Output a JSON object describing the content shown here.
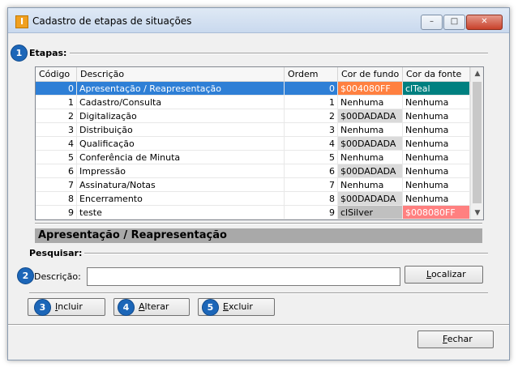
{
  "window": {
    "title": "Cadastro de etapas de situações",
    "app_icon": "I",
    "controls": {
      "minimize": "–",
      "maximize": "□",
      "close": "✕"
    }
  },
  "section_etapas": {
    "badge": "1",
    "label": "Etapas:"
  },
  "grid": {
    "columns": [
      "Código",
      "Descrição",
      "Ordem",
      "Cor de fundo",
      "Cor da fonte"
    ],
    "rows": [
      {
        "codigo": "0",
        "descricao": "Apresentação / Reapresentação",
        "ordem": "0",
        "cor_fundo": "$004080FF",
        "cor_fonte": "clTeal",
        "bg_color": "#ff8040",
        "fg_color": "#008080",
        "selected": true
      },
      {
        "codigo": "1",
        "descricao": "Cadastro/Consulta",
        "ordem": "1",
        "cor_fundo": "Nenhuma",
        "cor_fonte": "Nenhuma"
      },
      {
        "codigo": "2",
        "descricao": "Digitalização",
        "ordem": "2",
        "cor_fundo": "$00DADADA",
        "cor_fonte": "Nenhuma",
        "bg_color": "#dadada"
      },
      {
        "codigo": "3",
        "descricao": "Distribuição",
        "ordem": "3",
        "cor_fundo": "Nenhuma",
        "cor_fonte": "Nenhuma"
      },
      {
        "codigo": "4",
        "descricao": "Qualificação",
        "ordem": "4",
        "cor_fundo": "$00DADADA",
        "cor_fonte": "Nenhuma",
        "bg_color": "#dadada"
      },
      {
        "codigo": "5",
        "descricao": "Conferência de Minuta",
        "ordem": "5",
        "cor_fundo": "Nenhuma",
        "cor_fonte": "Nenhuma"
      },
      {
        "codigo": "6",
        "descricao": "Impressão",
        "ordem": "6",
        "cor_fundo": "$00DADADA",
        "cor_fonte": "Nenhuma",
        "bg_color": "#dadada"
      },
      {
        "codigo": "7",
        "descricao": "Assinatura/Notas",
        "ordem": "7",
        "cor_fundo": "Nenhuma",
        "cor_fonte": "Nenhuma"
      },
      {
        "codigo": "8",
        "descricao": "Encerramento",
        "ordem": "8",
        "cor_fundo": "$00DADADA",
        "cor_fonte": "Nenhuma",
        "bg_color": "#dadada"
      },
      {
        "codigo": "9",
        "descricao": "teste",
        "ordem": "9",
        "cor_fundo": "clSilver",
        "cor_fonte": "$008080FF",
        "bg_color": "#c0c0c0",
        "fg_color": "#ff8080"
      }
    ],
    "scroll_up": "▲",
    "scroll_down": "▼"
  },
  "selected_detail": "Apresentação / Reapresentação",
  "section_pesquisar": {
    "label": "Pesquisar:",
    "badge": "2",
    "descricao_label": "Descrição:",
    "descricao_value": "",
    "localizar": {
      "accel": "L",
      "rest": "ocalizar"
    }
  },
  "buttons": {
    "incluir": {
      "badge": "3",
      "accel": "I",
      "rest": "ncluir"
    },
    "alterar": {
      "badge": "4",
      "accel": "A",
      "rest": "lterar"
    },
    "excluir": {
      "badge": "5",
      "accel": "E",
      "rest": "xcluir"
    },
    "fechar": {
      "accel": "F",
      "rest": "echar"
    }
  },
  "colors": {
    "selection": "#2e7fd6",
    "badge": "#1c66b8",
    "detail_bar": "#a9a9a9"
  }
}
